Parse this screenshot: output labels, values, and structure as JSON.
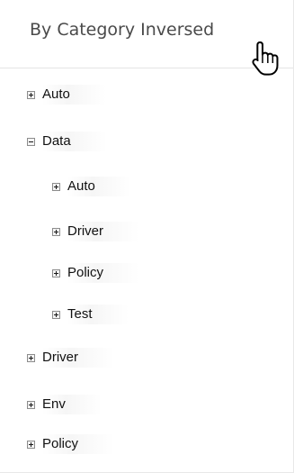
{
  "header": {
    "title": "By Category Inversed",
    "cursor_icon": "hand-pointer-icon"
  },
  "tree": {
    "items": [
      {
        "label": "Auto",
        "expanded": false,
        "level": 0
      },
      {
        "label": "Data",
        "expanded": true,
        "level": 0
      },
      {
        "label": "Auto",
        "expanded": false,
        "level": 1
      },
      {
        "label": "Driver",
        "expanded": false,
        "level": 1
      },
      {
        "label": "Policy",
        "expanded": false,
        "level": 1
      },
      {
        "label": "Test",
        "expanded": false,
        "level": 1
      },
      {
        "label": "Driver",
        "expanded": false,
        "level": 0
      },
      {
        "label": "Env",
        "expanded": false,
        "level": 0
      },
      {
        "label": "Policy",
        "expanded": false,
        "level": 0
      }
    ]
  }
}
